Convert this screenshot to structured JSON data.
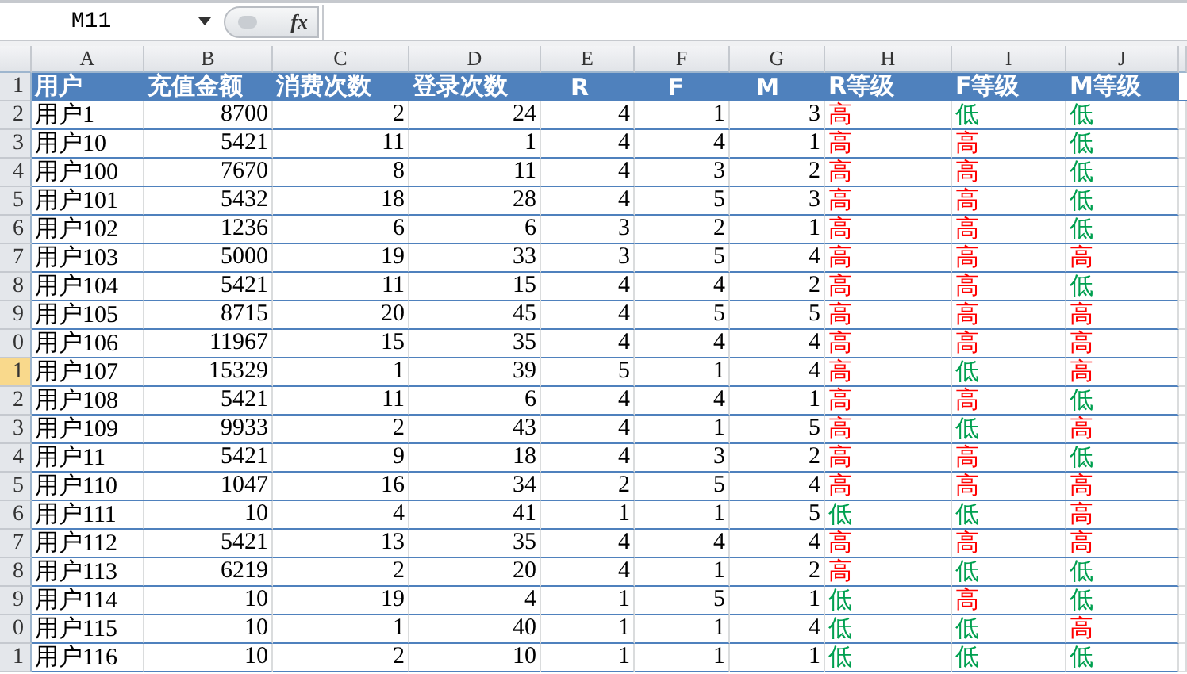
{
  "formula_bar": {
    "name_box": "M11",
    "fx": "fx"
  },
  "column_headers": [
    "A",
    "B",
    "C",
    "D",
    "E",
    "F",
    "G",
    "H",
    "I",
    "J"
  ],
  "header_row": {
    "row_number": "1",
    "selected": false,
    "cells": [
      "用户",
      "充值金额",
      "消费次数",
      "登录次数",
      "R",
      "F",
      "M",
      "R等级",
      "F等级",
      "M等级"
    ]
  },
  "rows": [
    {
      "row_number": "2",
      "selected": false,
      "cells": [
        "用户1",
        "8700",
        "2",
        "24",
        "4",
        "1",
        "3"
      ],
      "grades": [
        {
          "text": "高",
          "color": "#ff0000"
        },
        {
          "text": "低",
          "color": "#00a050"
        },
        {
          "text": "低",
          "color": "#00a050"
        }
      ]
    },
    {
      "row_number": "3",
      "selected": false,
      "cells": [
        "用户10",
        "5421",
        "11",
        "1",
        "4",
        "4",
        "1"
      ],
      "grades": [
        {
          "text": "高",
          "color": "#ff0000"
        },
        {
          "text": "高",
          "color": "#ff0000"
        },
        {
          "text": "低",
          "color": "#00a050"
        }
      ]
    },
    {
      "row_number": "4",
      "selected": false,
      "cells": [
        "用户100",
        "7670",
        "8",
        "11",
        "4",
        "3",
        "2"
      ],
      "grades": [
        {
          "text": "高",
          "color": "#ff0000"
        },
        {
          "text": "高",
          "color": "#ff0000"
        },
        {
          "text": "低",
          "color": "#00a050"
        }
      ]
    },
    {
      "row_number": "5",
      "selected": false,
      "cells": [
        "用户101",
        "5432",
        "18",
        "28",
        "4",
        "5",
        "3"
      ],
      "grades": [
        {
          "text": "高",
          "color": "#ff0000"
        },
        {
          "text": "高",
          "color": "#ff0000"
        },
        {
          "text": "低",
          "color": "#00a050"
        }
      ]
    },
    {
      "row_number": "6",
      "selected": false,
      "cells": [
        "用户102",
        "1236",
        "6",
        "6",
        "3",
        "2",
        "1"
      ],
      "grades": [
        {
          "text": "高",
          "color": "#ff0000"
        },
        {
          "text": "高",
          "color": "#ff0000"
        },
        {
          "text": "低",
          "color": "#00a050"
        }
      ]
    },
    {
      "row_number": "7",
      "selected": false,
      "cells": [
        "用户103",
        "5000",
        "19",
        "33",
        "3",
        "5",
        "4"
      ],
      "grades": [
        {
          "text": "高",
          "color": "#ff0000"
        },
        {
          "text": "高",
          "color": "#ff0000"
        },
        {
          "text": "高",
          "color": "#ff0000"
        }
      ]
    },
    {
      "row_number": "8",
      "selected": false,
      "cells": [
        "用户104",
        "5421",
        "11",
        "15",
        "4",
        "4",
        "2"
      ],
      "grades": [
        {
          "text": "高",
          "color": "#ff0000"
        },
        {
          "text": "高",
          "color": "#ff0000"
        },
        {
          "text": "低",
          "color": "#00a050"
        }
      ]
    },
    {
      "row_number": "9",
      "selected": false,
      "cells": [
        "用户105",
        "8715",
        "20",
        "45",
        "4",
        "5",
        "5"
      ],
      "grades": [
        {
          "text": "高",
          "color": "#ff0000"
        },
        {
          "text": "高",
          "color": "#ff0000"
        },
        {
          "text": "高",
          "color": "#ff0000"
        }
      ]
    },
    {
      "row_number": "0",
      "selected": false,
      "cells": [
        "用户106",
        "11967",
        "15",
        "35",
        "4",
        "4",
        "4"
      ],
      "grades": [
        {
          "text": "高",
          "color": "#ff0000"
        },
        {
          "text": "高",
          "color": "#ff0000"
        },
        {
          "text": "高",
          "color": "#ff0000"
        }
      ]
    },
    {
      "row_number": "1",
      "selected": true,
      "cells": [
        "用户107",
        "15329",
        "1",
        "39",
        "5",
        "1",
        "4"
      ],
      "grades": [
        {
          "text": "高",
          "color": "#ff0000"
        },
        {
          "text": "低",
          "color": "#00a050"
        },
        {
          "text": "高",
          "color": "#ff0000"
        }
      ]
    },
    {
      "row_number": "2",
      "selected": false,
      "cells": [
        "用户108",
        "5421",
        "11",
        "6",
        "4",
        "4",
        "1"
      ],
      "grades": [
        {
          "text": "高",
          "color": "#ff0000"
        },
        {
          "text": "高",
          "color": "#ff0000"
        },
        {
          "text": "低",
          "color": "#00a050"
        }
      ]
    },
    {
      "row_number": "3",
      "selected": false,
      "cells": [
        "用户109",
        "9933",
        "2",
        "43",
        "4",
        "1",
        "5"
      ],
      "grades": [
        {
          "text": "高",
          "color": "#ff0000"
        },
        {
          "text": "低",
          "color": "#00a050"
        },
        {
          "text": "高",
          "color": "#ff0000"
        }
      ]
    },
    {
      "row_number": "4",
      "selected": false,
      "cells": [
        "用户11",
        "5421",
        "9",
        "18",
        "4",
        "3",
        "2"
      ],
      "grades": [
        {
          "text": "高",
          "color": "#ff0000"
        },
        {
          "text": "高",
          "color": "#ff0000"
        },
        {
          "text": "低",
          "color": "#00a050"
        }
      ]
    },
    {
      "row_number": "5",
      "selected": false,
      "cells": [
        "用户110",
        "1047",
        "16",
        "34",
        "2",
        "5",
        "4"
      ],
      "grades": [
        {
          "text": "高",
          "color": "#ff0000"
        },
        {
          "text": "高",
          "color": "#ff0000"
        },
        {
          "text": "高",
          "color": "#ff0000"
        }
      ]
    },
    {
      "row_number": "6",
      "selected": false,
      "cells": [
        "用户111",
        "10",
        "4",
        "41",
        "1",
        "1",
        "5"
      ],
      "grades": [
        {
          "text": "低",
          "color": "#00a050"
        },
        {
          "text": "低",
          "color": "#00a050"
        },
        {
          "text": "高",
          "color": "#ff0000"
        }
      ]
    },
    {
      "row_number": "7",
      "selected": false,
      "cells": [
        "用户112",
        "5421",
        "13",
        "35",
        "4",
        "4",
        "4"
      ],
      "grades": [
        {
          "text": "高",
          "color": "#ff0000"
        },
        {
          "text": "高",
          "color": "#ff0000"
        },
        {
          "text": "高",
          "color": "#ff0000"
        }
      ]
    },
    {
      "row_number": "8",
      "selected": false,
      "cells": [
        "用户113",
        "6219",
        "2",
        "20",
        "4",
        "1",
        "2"
      ],
      "grades": [
        {
          "text": "高",
          "color": "#ff0000"
        },
        {
          "text": "低",
          "color": "#00a050"
        },
        {
          "text": "低",
          "color": "#00a050"
        }
      ]
    },
    {
      "row_number": "9",
      "selected": false,
      "cells": [
        "用户114",
        "10",
        "19",
        "4",
        "1",
        "5",
        "1"
      ],
      "grades": [
        {
          "text": "低",
          "color": "#00a050"
        },
        {
          "text": "高",
          "color": "#ff0000"
        },
        {
          "text": "低",
          "color": "#00a050"
        }
      ]
    },
    {
      "row_number": "0",
      "selected": false,
      "cells": [
        "用户115",
        "10",
        "1",
        "40",
        "1",
        "1",
        "4"
      ],
      "grades": [
        {
          "text": "低",
          "color": "#00a050"
        },
        {
          "text": "低",
          "color": "#00a050"
        },
        {
          "text": "高",
          "color": "#ff0000"
        }
      ]
    },
    {
      "row_number": "1",
      "selected": false,
      "cells": [
        "用户116",
        "10",
        "2",
        "10",
        "1",
        "1",
        "1"
      ],
      "grades": [
        {
          "text": "低",
          "color": "#00a050"
        },
        {
          "text": "低",
          "color": "#00a050"
        },
        {
          "text": "低",
          "color": "#00a050"
        }
      ]
    }
  ]
}
